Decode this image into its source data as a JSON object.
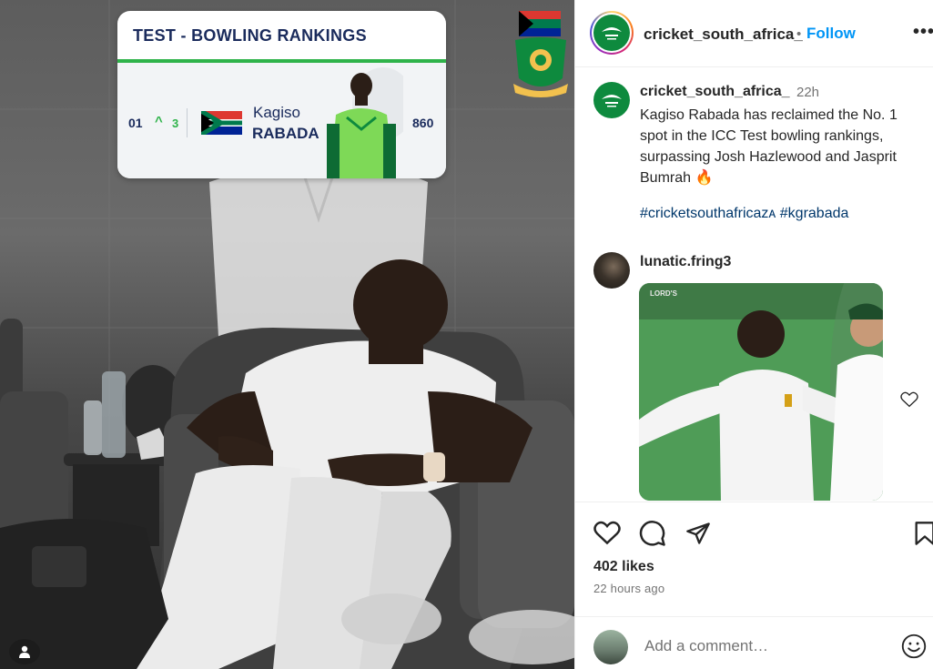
{
  "post_image": {
    "ranking_card": {
      "title": "TEST - BOWLING RANKINGS",
      "position": "01",
      "arrow": "^",
      "change": "3",
      "first_name": "Kagiso",
      "last_name": "RABADA",
      "points": "860"
    }
  },
  "header": {
    "username": "cricket_south_africa_",
    "separator": "•",
    "follow_label": "Follow",
    "more_label": "•••"
  },
  "caption": {
    "username": "cricket_south_africa_",
    "time": "22h",
    "text": "Kagiso Rabada has reclaimed the No. 1 spot in the ICC Test bowling rankings, surpassing Josh Hazlewood and Jasprit Bumrah",
    "emoji": "🔥",
    "hashtag_1": "#cricketsouthafricaᴢᴀ",
    "hashtag_2": "#kgrabada"
  },
  "comment": {
    "username": "lunatic.fring3",
    "media_watermark": "LORD'S"
  },
  "actions": {
    "likes": "402 likes",
    "time": "22 hours ago"
  },
  "add_comment": {
    "placeholder": "Add a comment…"
  },
  "colors": {
    "follow_blue": "#0095f6",
    "hashtag_navy": "#00376b",
    "csa_green": "#0e8a3e",
    "rank_green": "#2fb34a",
    "rank_navy": "#1a2b5c"
  },
  "icons": [
    "heart-icon",
    "comment-icon",
    "share-icon",
    "bookmark-icon",
    "emoji-icon",
    "user-tag-icon",
    "more-icon"
  ]
}
